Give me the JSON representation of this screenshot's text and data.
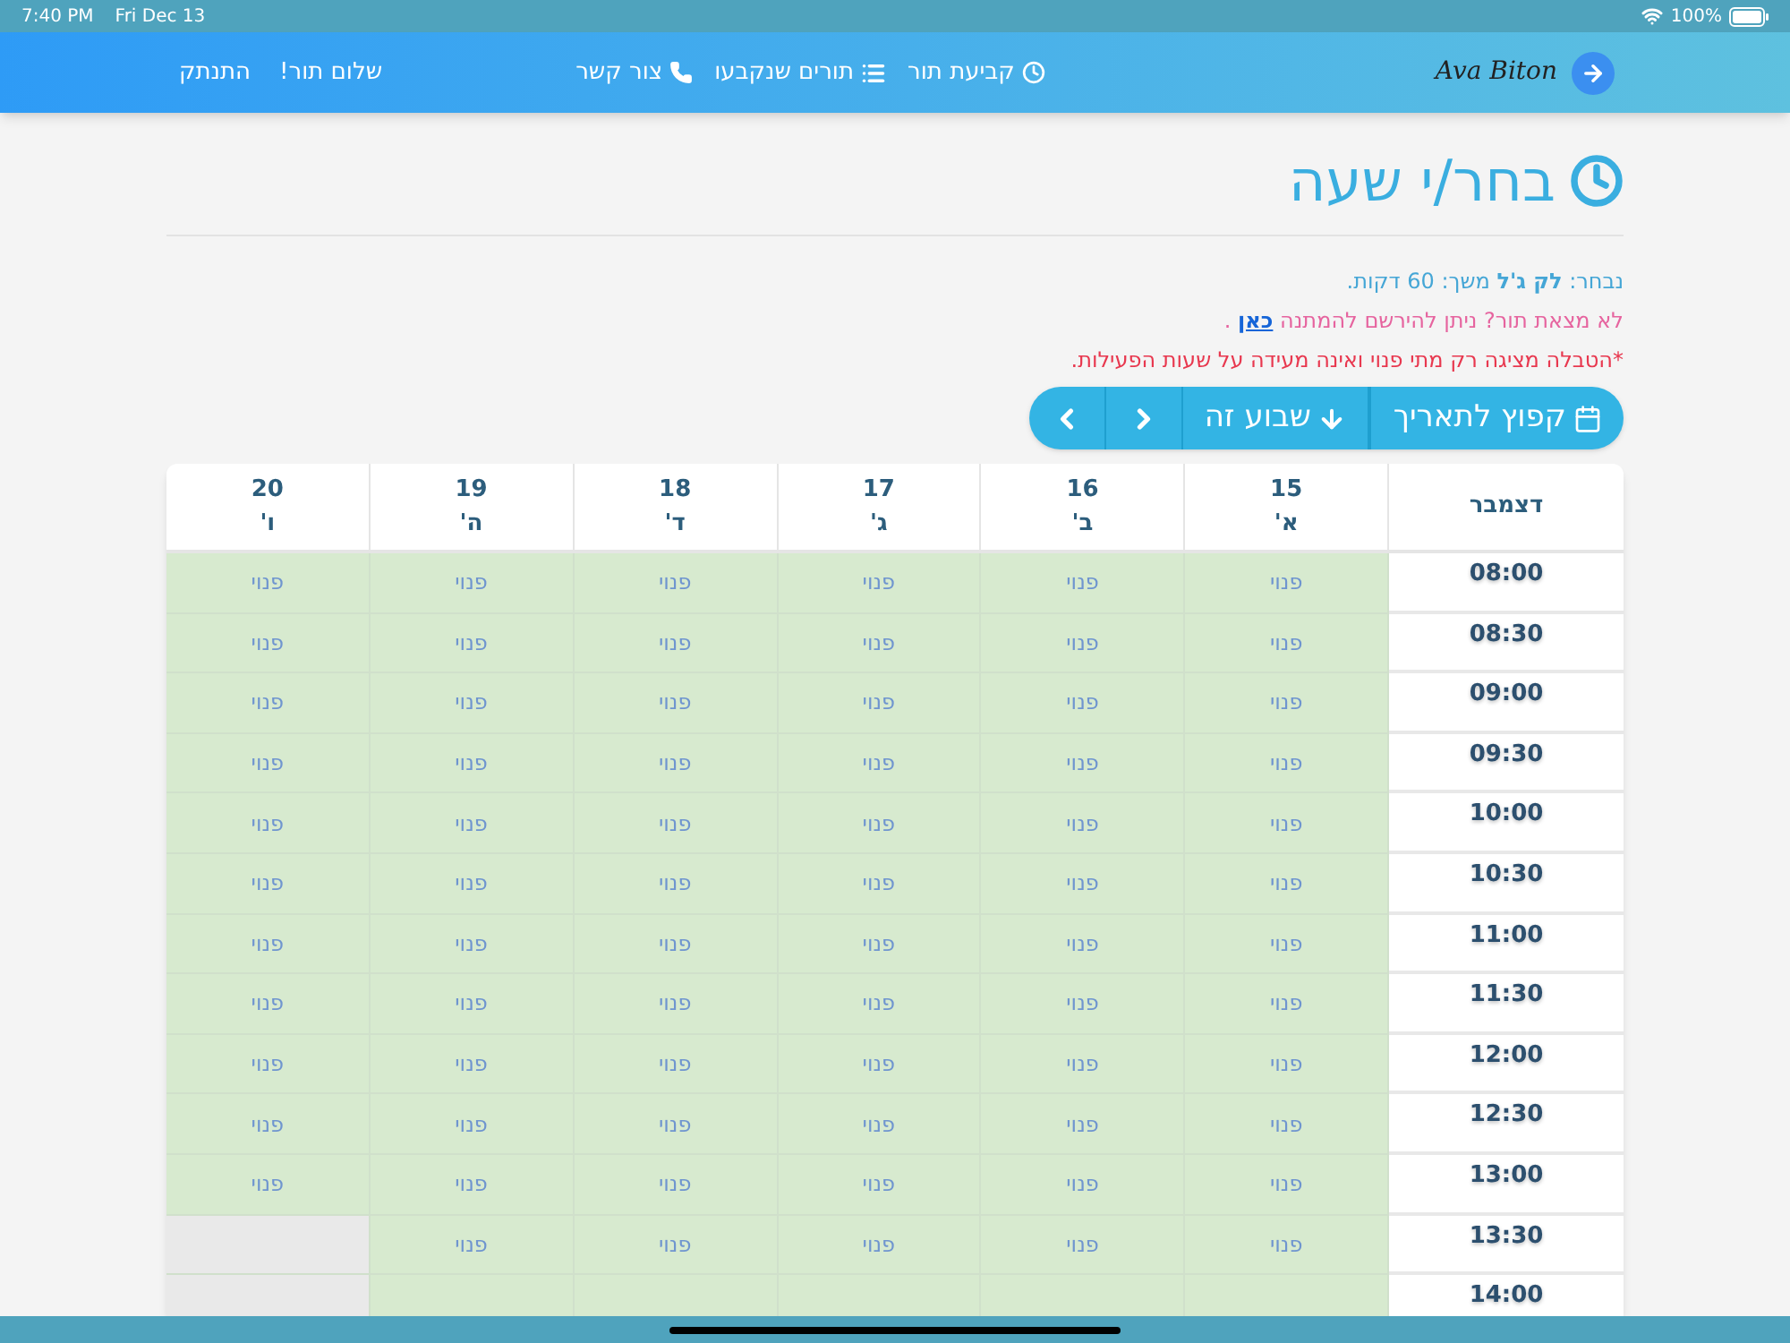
{
  "status_bar": {
    "time": "7:40 PM",
    "date": "Fri Dec 13",
    "battery": "100%"
  },
  "nav": {
    "logo": "Ava Biton",
    "links": [
      {
        "label": "קביעת תור"
      },
      {
        "label": "תורים שנקבעו"
      },
      {
        "label": "צור קשר"
      }
    ],
    "greeting": "שלום תור!",
    "logout": "התנתק"
  },
  "title": "בחר/י שעה",
  "info": {
    "selected": "נבחר: **לק ג'ל** משך: 60 דקות.",
    "waitlist": "לא מצאת תור? ניתן להירשם להמתנה",
    "waitlist_link": "כאן",
    "waitlist_end": " .",
    "note": "*הטבלה מציגה רק מתי פנוי ואינה מעידה על שעות הפעילות."
  },
  "toolbar": [
    {
      "kind": "date",
      "label": "קפוץ  לתאריך"
    },
    {
      "kind": "week",
      "label": "שבוע זה"
    },
    {
      "kind": "next"
    },
    {
      "kind": "prev"
    }
  ],
  "table": {
    "month": "דצמבר",
    "days": [
      {
        "date": "15",
        "day": "א'"
      },
      {
        "date": "16",
        "day": "ב'"
      },
      {
        "date": "17",
        "day": "ג'"
      },
      {
        "date": "18",
        "day": "ד'"
      },
      {
        "date": "19",
        "day": "ה'"
      },
      {
        "date": "20",
        "day": "ו'"
      }
    ],
    "rows": [
      {
        "time": "08:00",
        "cells": [
          {
            "available": true,
            "label": "פנוי"
          },
          {
            "available": true,
            "label": "פנוי"
          },
          {
            "available": true,
            "label": "פנוי"
          },
          {
            "available": true,
            "label": "פנוי"
          },
          {
            "available": true,
            "label": "פנוי"
          },
          {
            "available": true,
            "label": "פנוי"
          }
        ]
      },
      {
        "time": "08:30",
        "cells": [
          {
            "available": true,
            "label": "פנוי"
          },
          {
            "available": true,
            "label": "פנוי"
          },
          {
            "available": true,
            "label": "פנוי"
          },
          {
            "available": true,
            "label": "פנוי"
          },
          {
            "available": true,
            "label": "פנוי"
          },
          {
            "available": true,
            "label": "פנוי"
          }
        ]
      },
      {
        "time": "09:00",
        "cells": [
          {
            "available": true,
            "label": "פנוי"
          },
          {
            "available": true,
            "label": "פנוי"
          },
          {
            "available": true,
            "label": "פנוי"
          },
          {
            "available": true,
            "label": "פנוי"
          },
          {
            "available": true,
            "label": "פנוי"
          },
          {
            "available": true,
            "label": "פנוי"
          }
        ]
      },
      {
        "time": "09:30",
        "cells": [
          {
            "available": true,
            "label": "פנוי"
          },
          {
            "available": true,
            "label": "פנוי"
          },
          {
            "available": true,
            "label": "פנוי"
          },
          {
            "available": true,
            "label": "פנוי"
          },
          {
            "available": true,
            "label": "פנוי"
          },
          {
            "available": true,
            "label": "פנוי"
          }
        ]
      },
      {
        "time": "10:00",
        "cells": [
          {
            "available": true,
            "label": "פנוי"
          },
          {
            "available": true,
            "label": "פנוי"
          },
          {
            "available": true,
            "label": "פנוי"
          },
          {
            "available": true,
            "label": "פנוי"
          },
          {
            "available": true,
            "label": "פנוי"
          },
          {
            "available": true,
            "label": "פנוי"
          }
        ]
      },
      {
        "time": "10:30",
        "cells": [
          {
            "available": true,
            "label": "פנוי"
          },
          {
            "available": true,
            "label": "פנוי"
          },
          {
            "available": true,
            "label": "פנוי"
          },
          {
            "available": true,
            "label": "פנוי"
          },
          {
            "available": true,
            "label": "פנוי"
          },
          {
            "available": true,
            "label": "פנוי"
          }
        ]
      },
      {
        "time": "11:00",
        "cells": [
          {
            "available": true,
            "label": "פנוי"
          },
          {
            "available": true,
            "label": "פנוי"
          },
          {
            "available": true,
            "label": "פנוי"
          },
          {
            "available": true,
            "label": "פנוי"
          },
          {
            "available": true,
            "label": "פנוי"
          },
          {
            "available": true,
            "label": "פנוי"
          }
        ]
      },
      {
        "time": "11:30",
        "cells": [
          {
            "available": true,
            "label": "פנוי"
          },
          {
            "available": true,
            "label": "פנוי"
          },
          {
            "available": true,
            "label": "פנוי"
          },
          {
            "available": true,
            "label": "פנוי"
          },
          {
            "available": true,
            "label": "פנוי"
          },
          {
            "available": true,
            "label": "פנוי"
          }
        ]
      },
      {
        "time": "12:00",
        "cells": [
          {
            "available": true,
            "label": "פנוי"
          },
          {
            "available": true,
            "label": "פנוי"
          },
          {
            "available": true,
            "label": "פנוי"
          },
          {
            "available": true,
            "label": "פנוי"
          },
          {
            "available": true,
            "label": "פנוי"
          },
          {
            "available": true,
            "label": "פנוי"
          }
        ]
      },
      {
        "time": "12:30",
        "cells": [
          {
            "available": true,
            "label": "פנוי"
          },
          {
            "available": true,
            "label": "פנוי"
          },
          {
            "available": true,
            "label": "פנוי"
          },
          {
            "available": true,
            "label": "פנוי"
          },
          {
            "available": true,
            "label": "פנוי"
          },
          {
            "available": true,
            "label": "פנוי"
          }
        ]
      },
      {
        "time": "13:00",
        "cells": [
          {
            "available": true,
            "label": "פנוי"
          },
          {
            "available": true,
            "label": "פנוי"
          },
          {
            "available": true,
            "label": "פנוי"
          },
          {
            "available": true,
            "label": "פנוי"
          },
          {
            "available": true,
            "label": "פנוי"
          },
          {
            "available": true,
            "label": "פנוי"
          }
        ]
      },
      {
        "time": "13:30",
        "cells": [
          {
            "available": true,
            "label": "פנוי"
          },
          {
            "available": true,
            "label": "פנוי"
          },
          {
            "available": true,
            "label": "פנוי"
          },
          {
            "available": true,
            "label": "פנוי"
          },
          {
            "available": true,
            "label": "פנוי"
          },
          {
            "available": false
          }
        ]
      },
      {
        "time": "14:00",
        "cells": [
          {
            "available": true
          },
          {
            "available": true
          },
          {
            "available": true
          },
          {
            "available": true
          },
          {
            "available": true
          },
          {
            "available": false
          }
        ]
      }
    ]
  }
}
